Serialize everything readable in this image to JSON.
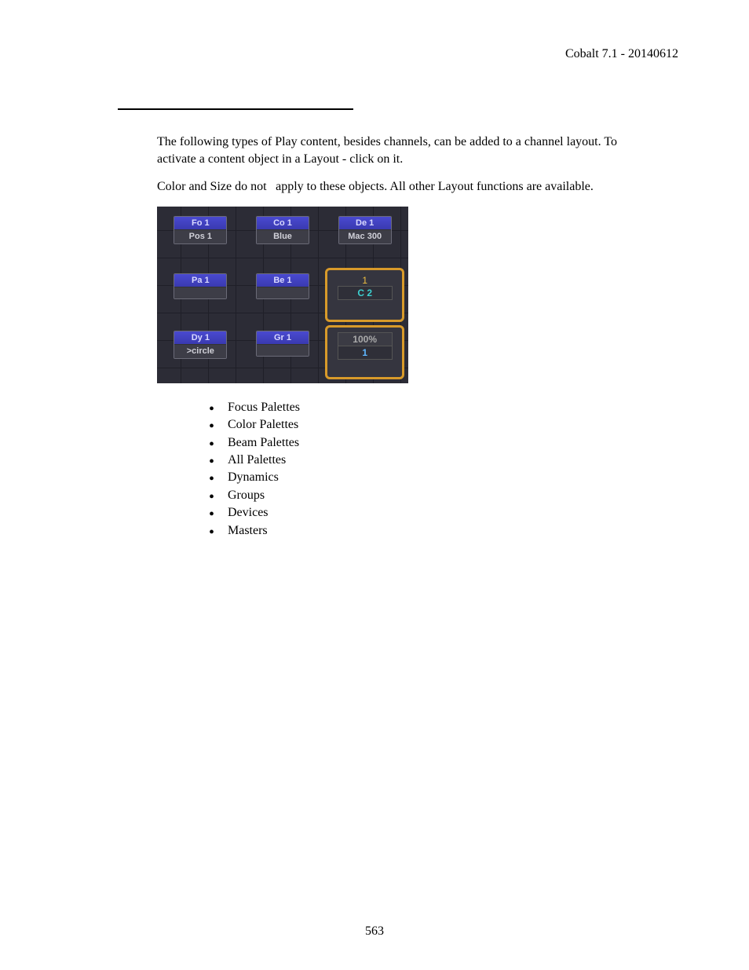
{
  "header": {
    "text": "Cobalt 7.1 - 20140612"
  },
  "body": {
    "para1": "The following types of Play content, besides channels, can be added to a channel layout. To activate a content object in a Layout - click on it.",
    "para2a": "Color and Size do ",
    "para2_not": "not",
    "para2b": "apply to these objects. All other Layout functions are available."
  },
  "ui": {
    "tiles": [
      {
        "head": "Fo 1",
        "sub": "Pos 1"
      },
      {
        "head": "Co 1",
        "sub": "Blue"
      },
      {
        "head": "De 1",
        "sub": "Mac 300"
      },
      {
        "head": "Pa 1",
        "sub": ""
      },
      {
        "head": "Be 1",
        "sub": ""
      },
      {
        "head": "Dy 1",
        "sub": ">circle"
      },
      {
        "head": "Gr 1",
        "sub": ""
      }
    ],
    "channel": {
      "num": "1",
      "name": "C 2"
    },
    "master": {
      "pct": "100%",
      "num": "1"
    }
  },
  "bullets": [
    "Focus Palettes",
    "Color Palettes",
    "Beam Palettes",
    "All Palettes",
    "Dynamics",
    "Groups",
    "Devices",
    "Masters"
  ],
  "page_number": "563"
}
